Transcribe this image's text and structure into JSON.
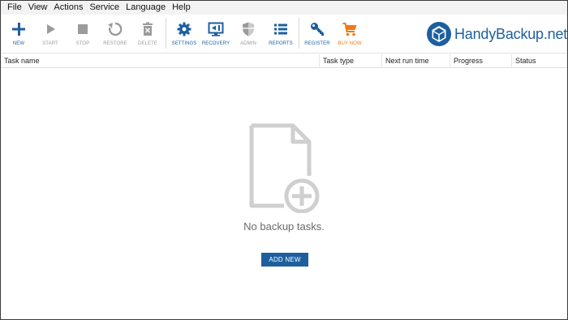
{
  "menu": [
    "File",
    "View",
    "Actions",
    "Service",
    "Language",
    "Help"
  ],
  "toolbar": {
    "new": "NEW",
    "start": "START",
    "stop": "STOP",
    "restore": "RESTORE",
    "delete": "DELETE",
    "settings": "SETTINGS",
    "recovery": "RECOVERY",
    "admin": "ADMIN",
    "reports": "REPORTS",
    "register": "REGISTER",
    "buy_now": "BUY NOW"
  },
  "logo": {
    "text": "HandyBackup.net"
  },
  "table": {
    "columns": [
      "Task name",
      "Task type",
      "Next run time",
      "Progress",
      "Status"
    ]
  },
  "empty_state": {
    "message": "No backup tasks.",
    "button": "ADD NEW"
  },
  "colors": {
    "accent": "#1d5f9f",
    "disabled": "#9b9b9b",
    "orange": "#f07a16"
  }
}
